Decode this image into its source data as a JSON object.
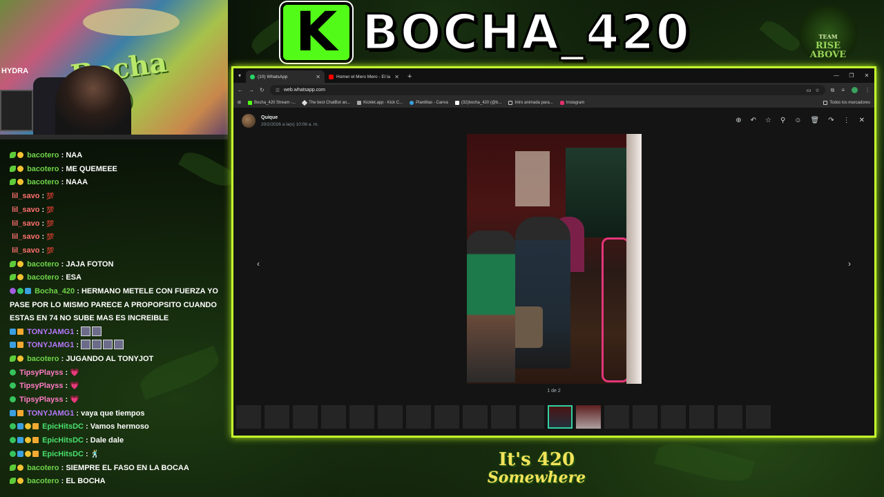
{
  "overlay": {
    "title": "BOCHA_420",
    "kick_letter": "K",
    "team_badge_line1": "TEAM",
    "team_badge_line2": "RISE ABOVE",
    "bottom_logo_line1": "It's 420",
    "bottom_logo_line2": "Somewhere"
  },
  "webcam": {
    "wall_text": "Bocha 420",
    "hydra_label": "HYDRA"
  },
  "chat": {
    "messages": [
      {
        "user": "bacotero",
        "text": "NAA"
      },
      {
        "user": "bacotero",
        "text": "ME QUEMEEE"
      },
      {
        "user": "bacotero",
        "text": "NAAA"
      },
      {
        "user": "lil_savo",
        "emote": "💯"
      },
      {
        "user": "lil_savo",
        "emote": "💯"
      },
      {
        "user": "lil_savo",
        "emote": "💯"
      },
      {
        "user": "lil_savo",
        "emote": "💯"
      },
      {
        "user": "lil_savo",
        "emote": "💯"
      },
      {
        "user": "bacotero",
        "text": "JAJA FOTON"
      },
      {
        "user": "bacotero",
        "text": "ESA"
      },
      {
        "user": "Bocha_420",
        "text": "HERMANO METELE CON FUERZA YO PASE POR LO MISMO PARECE A PROPOPSITO CUANDO ESTAS EN 74 NO SUBE MAS ES INCREIBLE"
      },
      {
        "user": "TONYJAMG1"
      },
      {
        "user": "TONYJAMG1"
      },
      {
        "user": "bacotero",
        "text": "JUGANDO AL TONYJOT"
      },
      {
        "user": "TipsyPlayss",
        "emote": "💗"
      },
      {
        "user": "TipsyPlayss",
        "emote": "💗"
      },
      {
        "user": "TipsyPlayss",
        "emote": "💗"
      },
      {
        "user": "TONYJAMG1",
        "text": "vaya que tiempos"
      },
      {
        "user": "EpicHitsDC",
        "text": "Vamos hermoso"
      },
      {
        "user": "EpicHitsDC",
        "text": "Dale dale"
      },
      {
        "user": "EpicHitsDC",
        "emote": "🕺"
      },
      {
        "user": "bacotero",
        "text": "SIEMPRE EL FASO EN LA BOCAA"
      },
      {
        "user": "bacotero",
        "text": "EL BOCHA"
      }
    ],
    "separator": ":"
  },
  "browser": {
    "tabs": [
      {
        "label": "(10) WhatsApp",
        "active": true
      },
      {
        "label": "Homer el Mero Mero - El la",
        "active": false
      }
    ],
    "url": "web.whatsapp.com",
    "bookmarks": [
      "Bocha_420 Stream -...",
      "The best ChatBot an...",
      "Kicklet.app - Kick C...",
      "Plantillas - Canva",
      "(32)bocha_420 (@b...",
      "Intro animada para...",
      "Instagram"
    ],
    "all_bookmarks": "Todos los marcadores"
  },
  "viewer": {
    "sender": "Quique",
    "timestamp": "20/2/2026 a la(s) 10:08 a. m.",
    "counter": "1 de 2"
  },
  "colors": {
    "frame_accent": "#c6ff2e",
    "kick_green": "#53fc18"
  }
}
